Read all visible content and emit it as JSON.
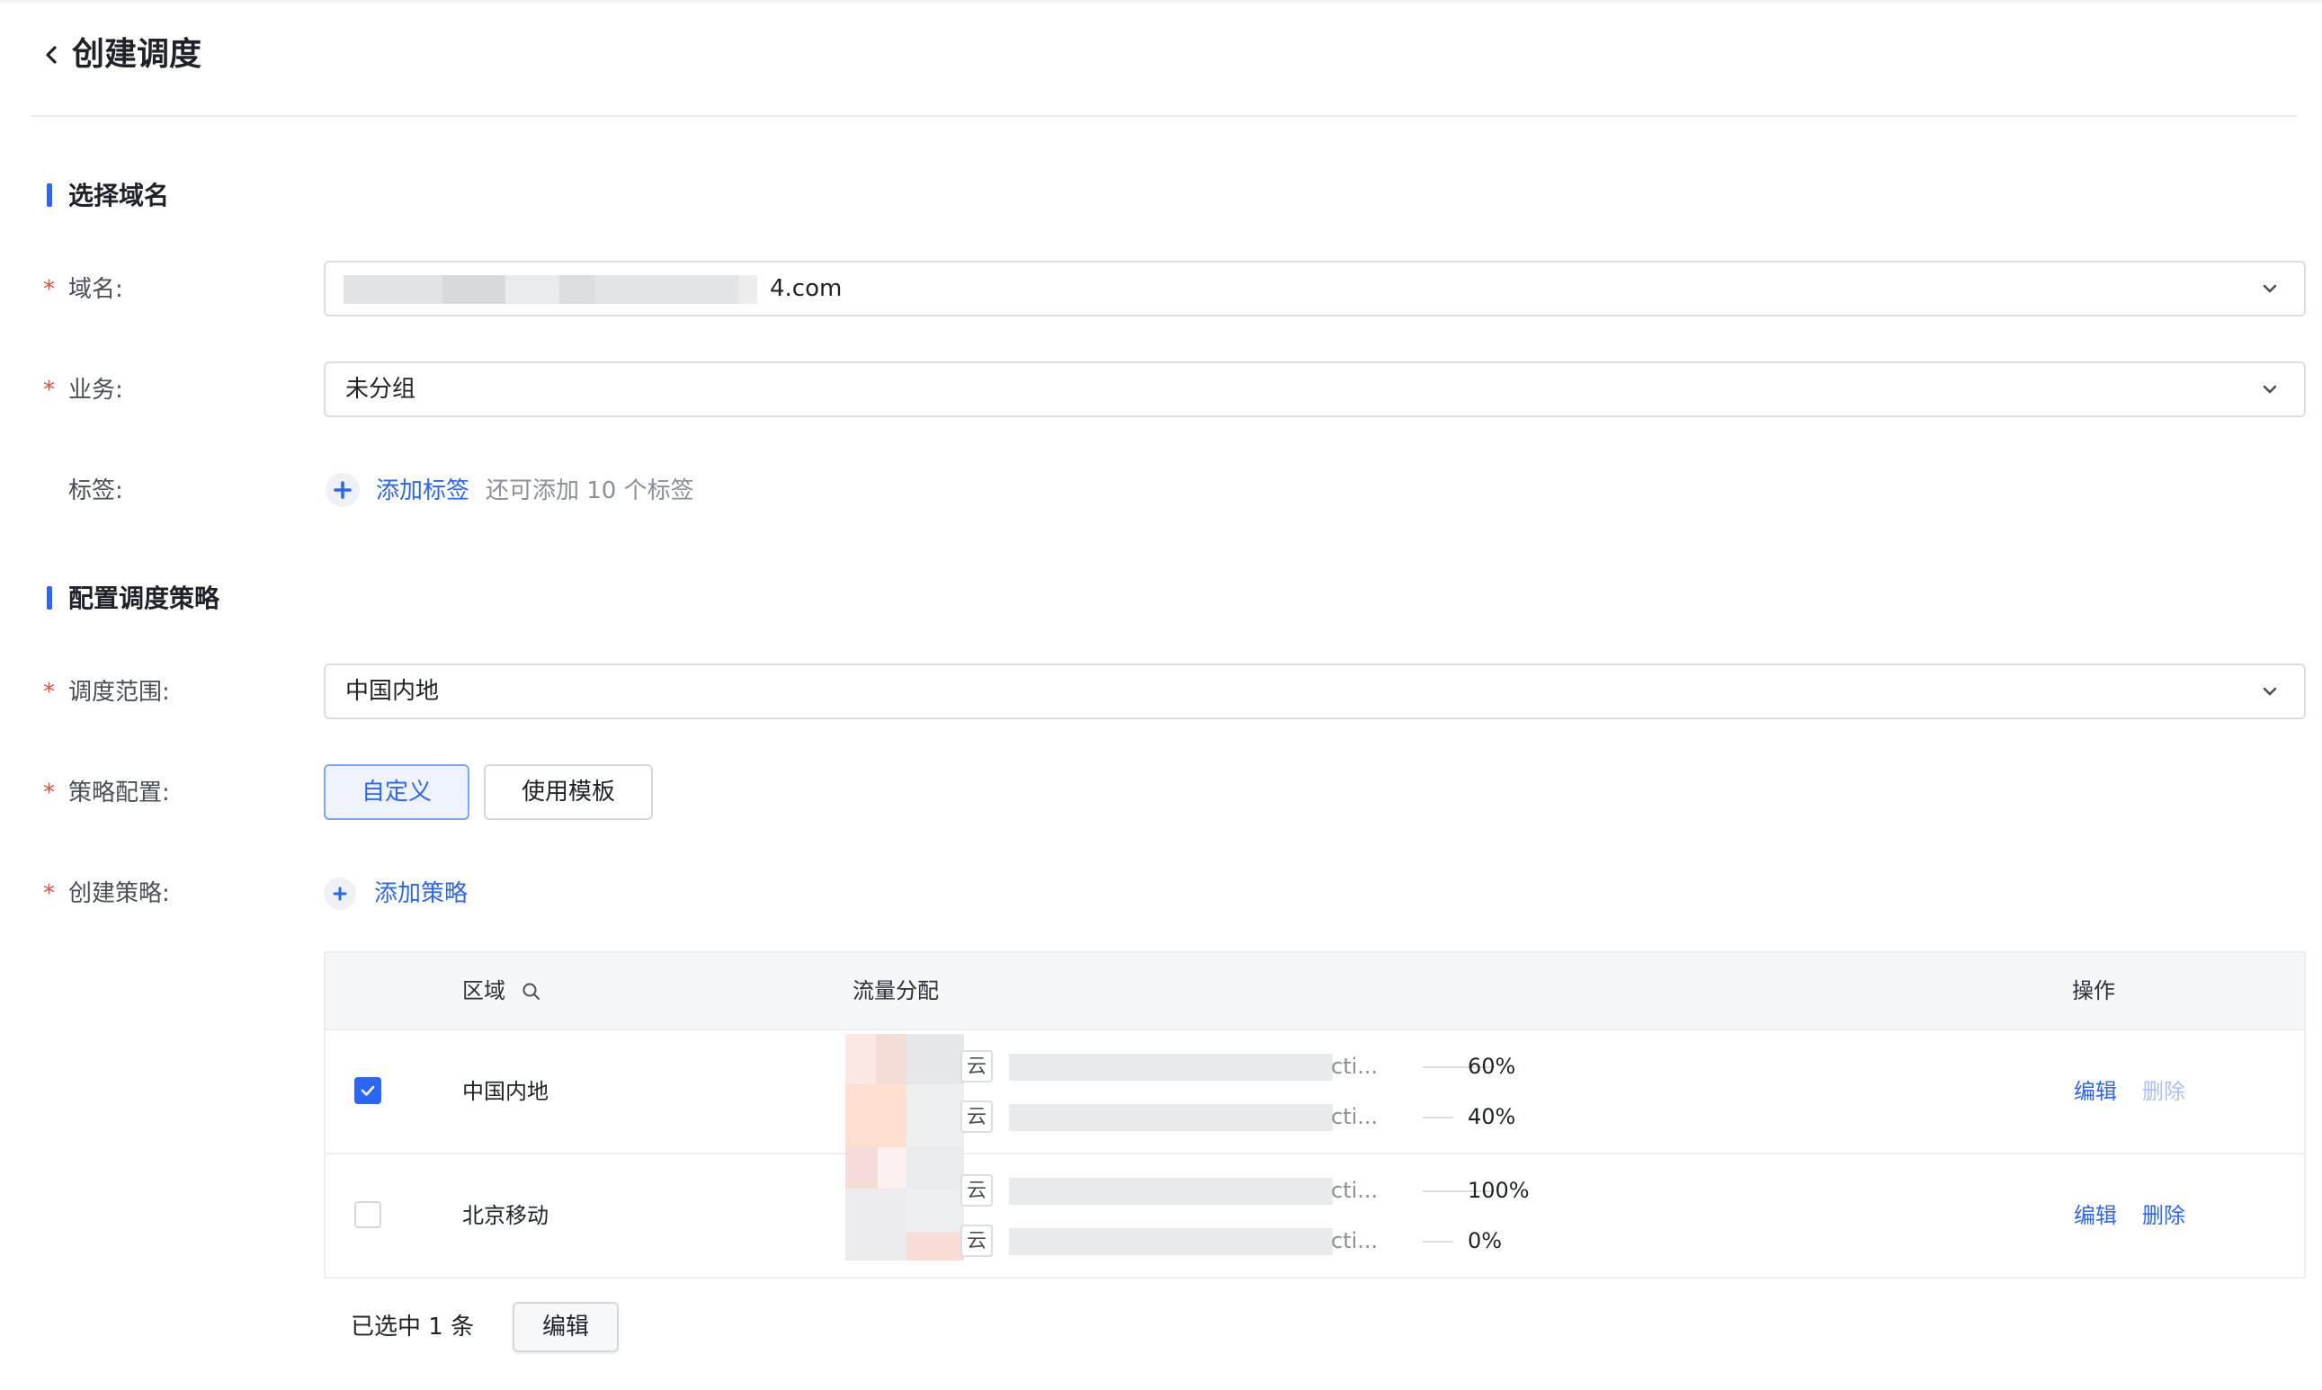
{
  "header": {
    "title": "创建调度"
  },
  "section1": {
    "title": "选择域名"
  },
  "domain": {
    "label": "域名:",
    "value": "4.com"
  },
  "business": {
    "label": "业务:",
    "value": "未分组"
  },
  "tags": {
    "label": "标签:",
    "add_label": "添加标签",
    "hint": "还可添加 10 个标签"
  },
  "section2": {
    "title": "配置调度策略"
  },
  "scope": {
    "label": "调度范围:",
    "value": "中国内地"
  },
  "strategy_config": {
    "label": "策略配置:",
    "options": [
      "自定义",
      "使用模板"
    ],
    "selected": "自定义"
  },
  "create_strategy": {
    "label": "创建策略:",
    "add_label": "添加策略"
  },
  "table": {
    "headers": {
      "region": "区域",
      "traffic": "流量分配",
      "actions": "操作"
    },
    "rows": [
      {
        "checked": true,
        "region": "中国内地",
        "allocations": [
          {
            "tag": "云",
            "suffix": "cti...",
            "percent": "60%"
          },
          {
            "tag": "云",
            "suffix": "cti...",
            "percent": "40%"
          }
        ],
        "edit": "编辑",
        "delete": "删除",
        "delete_disabled": true
      },
      {
        "checked": false,
        "region": "北京移动",
        "allocations": [
          {
            "tag": "云",
            "suffix": "cti...",
            "percent": "100%"
          },
          {
            "tag": "云",
            "suffix": "cti...",
            "percent": "0%"
          }
        ],
        "edit": "编辑",
        "delete": "删除",
        "delete_disabled": false
      }
    ]
  },
  "footer": {
    "selected_text": "已选中 1 条",
    "edit_button": "编辑"
  },
  "colors": {
    "accent": "#2b66f6",
    "required": "#f0473d",
    "disabled_link": "#a9c0f5"
  }
}
